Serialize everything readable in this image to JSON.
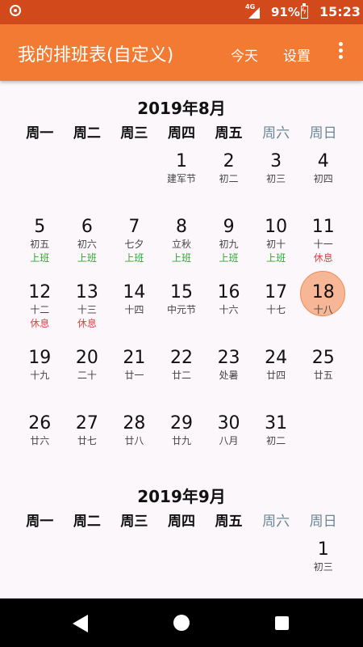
{
  "status": {
    "network": "4G",
    "battery": "91%",
    "time": "15:23"
  },
  "appbar": {
    "title": "我的排班表(自定义)",
    "today": "今天",
    "settings": "设置"
  },
  "weekdays": [
    "周一",
    "周二",
    "周三",
    "周四",
    "周五",
    "周六",
    "周日"
  ],
  "months": [
    {
      "title": "2019年8月",
      "selected_day": "18",
      "weeks": [
        [
          null,
          null,
          null,
          {
            "day": "1",
            "lunar": "建军节"
          },
          {
            "day": "2",
            "lunar": "初二"
          },
          {
            "day": "3",
            "lunar": "初三"
          },
          {
            "day": "4",
            "lunar": "初四"
          }
        ],
        [
          {
            "day": "5",
            "lunar": "初五",
            "tag": "上班",
            "tag_type": "work"
          },
          {
            "day": "6",
            "lunar": "初六",
            "tag": "上班",
            "tag_type": "work"
          },
          {
            "day": "7",
            "lunar": "七夕",
            "tag": "上班",
            "tag_type": "work"
          },
          {
            "day": "8",
            "lunar": "立秋",
            "tag": "上班",
            "tag_type": "work"
          },
          {
            "day": "9",
            "lunar": "初九",
            "tag": "上班",
            "tag_type": "work"
          },
          {
            "day": "10",
            "lunar": "初十",
            "tag": "上班",
            "tag_type": "work"
          },
          {
            "day": "11",
            "lunar": "十一",
            "tag": "休息",
            "tag_type": "rest"
          }
        ],
        [
          {
            "day": "12",
            "lunar": "十二",
            "tag": "休息",
            "tag_type": "rest"
          },
          {
            "day": "13",
            "lunar": "十三",
            "tag": "休息",
            "tag_type": "rest"
          },
          {
            "day": "14",
            "lunar": "十四"
          },
          {
            "day": "15",
            "lunar": "中元节"
          },
          {
            "day": "16",
            "lunar": "十六"
          },
          {
            "day": "17",
            "lunar": "十七"
          },
          {
            "day": "18",
            "lunar": "十八"
          }
        ],
        [
          {
            "day": "19",
            "lunar": "十九"
          },
          {
            "day": "20",
            "lunar": "二十"
          },
          {
            "day": "21",
            "lunar": "廿一"
          },
          {
            "day": "22",
            "lunar": "廿二"
          },
          {
            "day": "23",
            "lunar": "处暑"
          },
          {
            "day": "24",
            "lunar": "廿四"
          },
          {
            "day": "25",
            "lunar": "廿五"
          }
        ],
        [
          {
            "day": "26",
            "lunar": "廿六"
          },
          {
            "day": "27",
            "lunar": "廿七"
          },
          {
            "day": "28",
            "lunar": "廿八"
          },
          {
            "day": "29",
            "lunar": "廿九"
          },
          {
            "day": "30",
            "lunar": "八月"
          },
          {
            "day": "31",
            "lunar": "初二"
          },
          null
        ]
      ]
    },
    {
      "title": "2019年9月",
      "selected_day": "",
      "weeks": [
        [
          null,
          null,
          null,
          null,
          null,
          null,
          {
            "day": "1",
            "lunar": "初三"
          }
        ]
      ]
    }
  ]
}
